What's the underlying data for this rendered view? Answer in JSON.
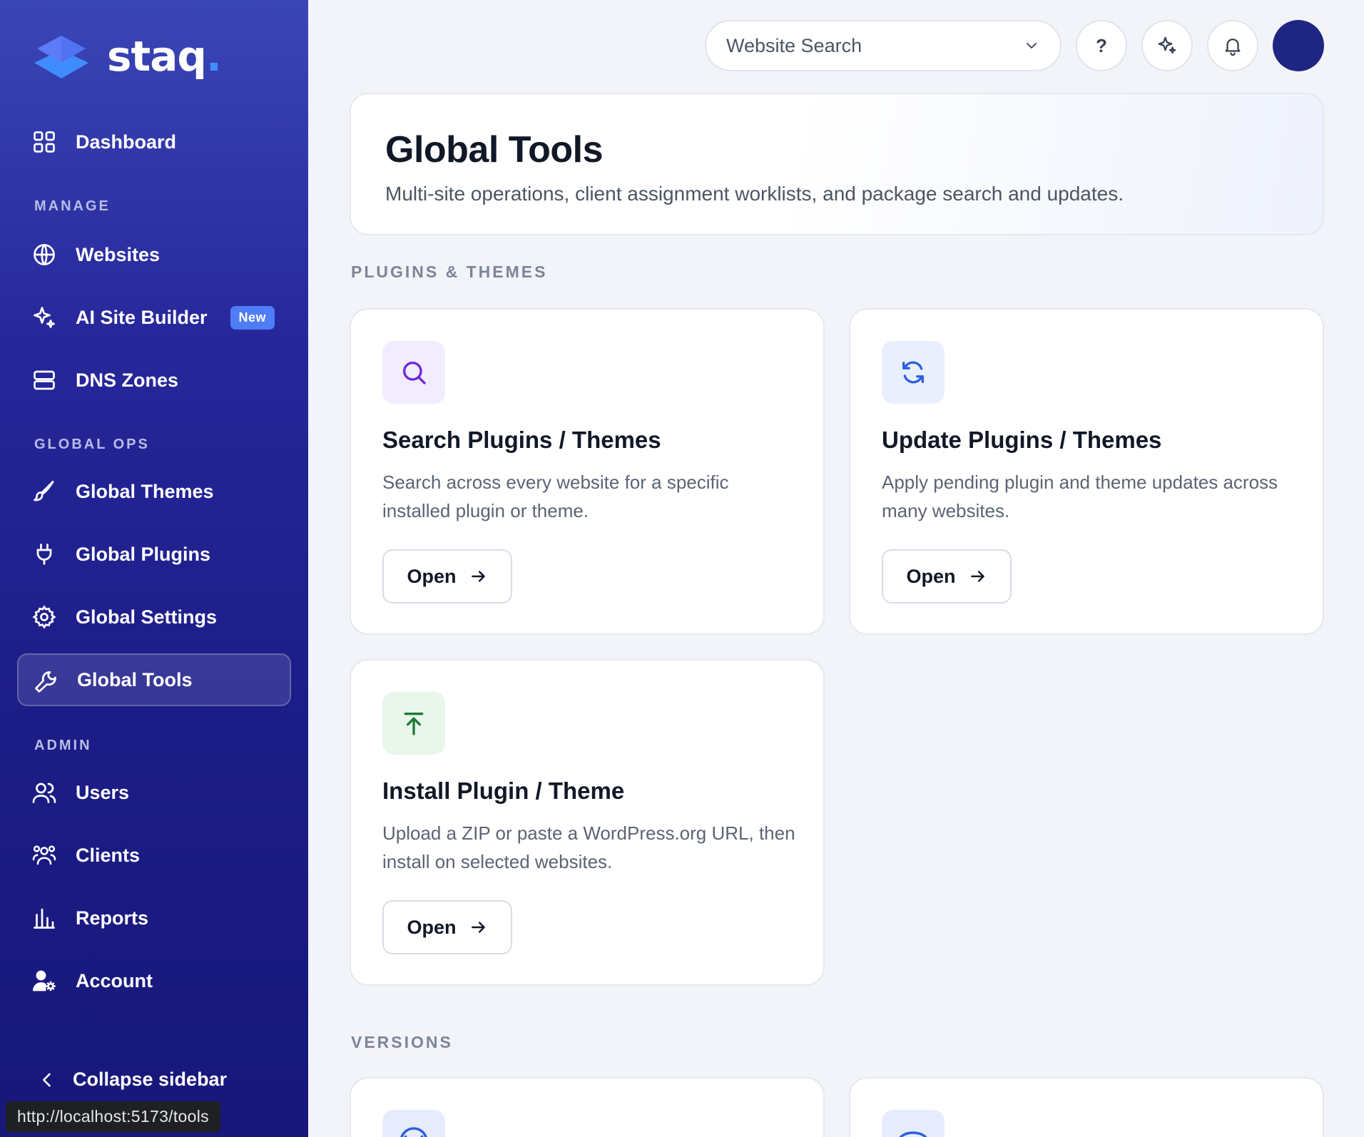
{
  "sidebar": {
    "logo_text": "staq",
    "logo_dot": ".",
    "dashboard": "Dashboard",
    "section_manage": "MANAGE",
    "websites": "Websites",
    "ai_site_builder": "AI Site Builder",
    "ai_badge": "New",
    "dns_zones": "DNS Zones",
    "section_global_ops": "GLOBAL OPS",
    "global_themes": "Global Themes",
    "global_plugins": "Global Plugins",
    "global_settings": "Global Settings",
    "global_tools": "Global Tools",
    "section_admin": "ADMIN",
    "users": "Users",
    "clients": "Clients",
    "reports": "Reports",
    "account": "Account",
    "collapse": "Collapse sidebar",
    "active_item": "Global Tools"
  },
  "status_bar": {
    "url": "http://localhost:5173/tools"
  },
  "topbar": {
    "search_placeholder": "Website Search",
    "help_label": "?"
  },
  "header": {
    "title": "Global Tools",
    "subtitle": "Multi-site operations, client assignment worklists, and package search and updates."
  },
  "sections": {
    "plugins_themes": "PLUGINS & THEMES",
    "versions": "VERSIONS"
  },
  "tools": [
    {
      "title": "Search Plugins / Themes",
      "description": "Search across every website for a specific installed plugin or theme.",
      "button": "Open",
      "icon": "search-icon"
    },
    {
      "title": "Update Plugins / Themes",
      "description": "Apply pending plugin and theme updates across many websites.",
      "button": "Open",
      "icon": "refresh-icon"
    },
    {
      "title": "Install Plugin / Theme",
      "description": "Upload a ZIP or paste a WordPress.org URL, then install on selected websites.",
      "button": "Open",
      "icon": "upload-icon"
    }
  ],
  "colors": {
    "sidebar_top": "#3b46b6",
    "sidebar_bottom": "#17187a",
    "badge": "#4f7df5",
    "search_icon_bg": "#f1ecfe",
    "search_icon_fg": "#6d28d9",
    "update_icon_bg": "#e9effd",
    "update_icon_fg": "#2f5fe0",
    "install_icon_bg": "#e8f6ec",
    "install_icon_fg": "#1f7a34",
    "avatar": "#1e2683"
  }
}
